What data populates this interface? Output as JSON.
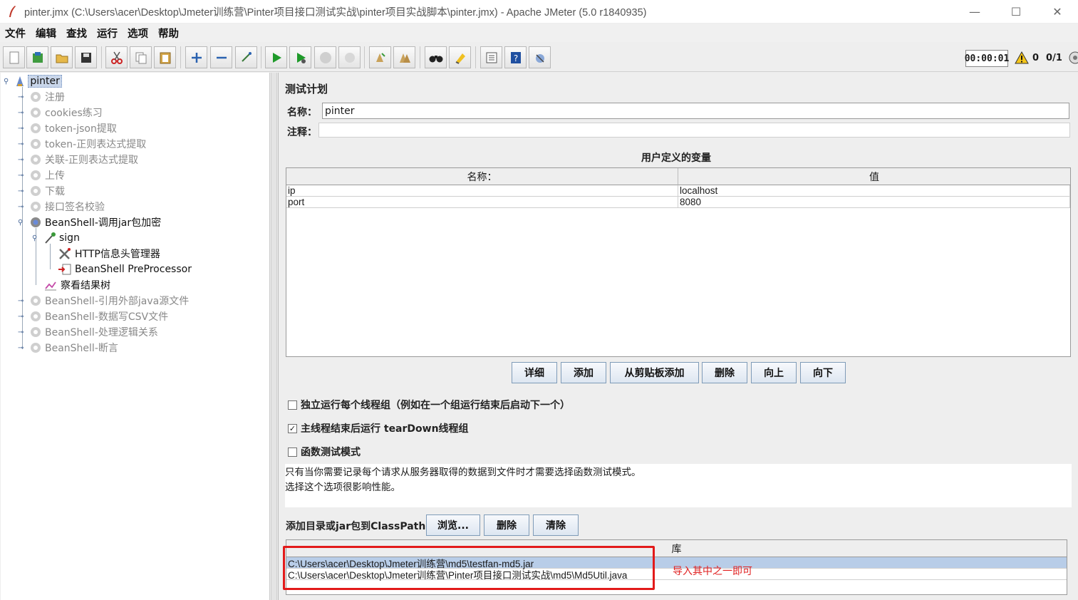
{
  "window": {
    "title": "pinter.jmx (C:\\Users\\acer\\Desktop\\Jmeter训练营\\Pinter项目接口测试实战\\pinter项目实战脚本\\pinter.jmx) - Apache JMeter (5.0 r1840935)",
    "minimize": "—",
    "maximize": "☐",
    "close": "✕"
  },
  "menu": [
    "文件",
    "编辑",
    "查找",
    "运行",
    "选项",
    "帮助"
  ],
  "status": {
    "timer": "00:00:01",
    "warnings": "0",
    "threads": "0/1"
  },
  "tree": [
    {
      "label": "pinter",
      "state": "selected"
    },
    {
      "label": "注册",
      "state": "disabled"
    },
    {
      "label": "cookies练习",
      "state": "disabled"
    },
    {
      "label": "token-json提取",
      "state": "disabled"
    },
    {
      "label": "token-正则表达式提取",
      "state": "disabled"
    },
    {
      "label": "关联-正则表达式提取",
      "state": "disabled"
    },
    {
      "label": "上传",
      "state": "disabled"
    },
    {
      "label": "下载",
      "state": "disabled"
    },
    {
      "label": "接口签名校验",
      "state": "disabled"
    },
    {
      "label": "BeanShell-调用jar包加密",
      "state": "enabled"
    },
    {
      "label": "sign",
      "state": "enabled"
    },
    {
      "label": "HTTP信息头管理器",
      "state": "enabled"
    },
    {
      "label": "BeanShell PreProcessor",
      "state": "enabled"
    },
    {
      "label": "察看结果树",
      "state": "enabled"
    },
    {
      "label": "BeanShell-引用外部java源文件",
      "state": "disabled"
    },
    {
      "label": "BeanShell-数据写CSV文件",
      "state": "disabled"
    },
    {
      "label": "BeanShell-处理逻辑关系",
      "state": "disabled"
    },
    {
      "label": "BeanShell-断言",
      "state": "disabled"
    }
  ],
  "plan": {
    "title": "测试计划",
    "name_label": "名称：",
    "name_value": "pinter",
    "comment_label": "注释：",
    "comment_value": ""
  },
  "variables": {
    "title": "用户定义的变量",
    "columns": [
      "名称：",
      "值"
    ],
    "rows": [
      {
        "name": "ip",
        "value": "localhost"
      },
      {
        "name": "port",
        "value": "8080"
      }
    ],
    "buttons": [
      "详细",
      "添加",
      "从剪贴板添加",
      "删除",
      "向上",
      "向下"
    ]
  },
  "options": [
    {
      "label": "独立运行每个线程组（例如在一个组运行结束后启动下一个）",
      "checked": false
    },
    {
      "label": "主线程结束后运行 tearDown线程组",
      "checked": true
    },
    {
      "label": "函数测试模式",
      "checked": false
    }
  ],
  "functional_note": {
    "line1": "只有当你需要记录每个请求从服务器取得的数据到文件时才需要选择函数测试模式。",
    "line2": "选择这个选项很影响性能。"
  },
  "classpath": {
    "label": "添加目录或jar包到ClassPath",
    "buttons": [
      "浏览...",
      "删除",
      "清除"
    ],
    "column": "库",
    "rows": [
      "C:\\Users\\acer\\Desktop\\Jmeter训练营\\md5\\testfan-md5.jar",
      "C:\\Users\\acer\\Desktop\\Jmeter训练营\\Pinter项目接口测试实战\\md5\\Md5Util.java"
    ]
  },
  "annotation": "导入其中之一即可",
  "colors": {
    "selection": "#c9d6ea",
    "annotation": "#e21a1a",
    "button_border": "#7f9bb8"
  }
}
